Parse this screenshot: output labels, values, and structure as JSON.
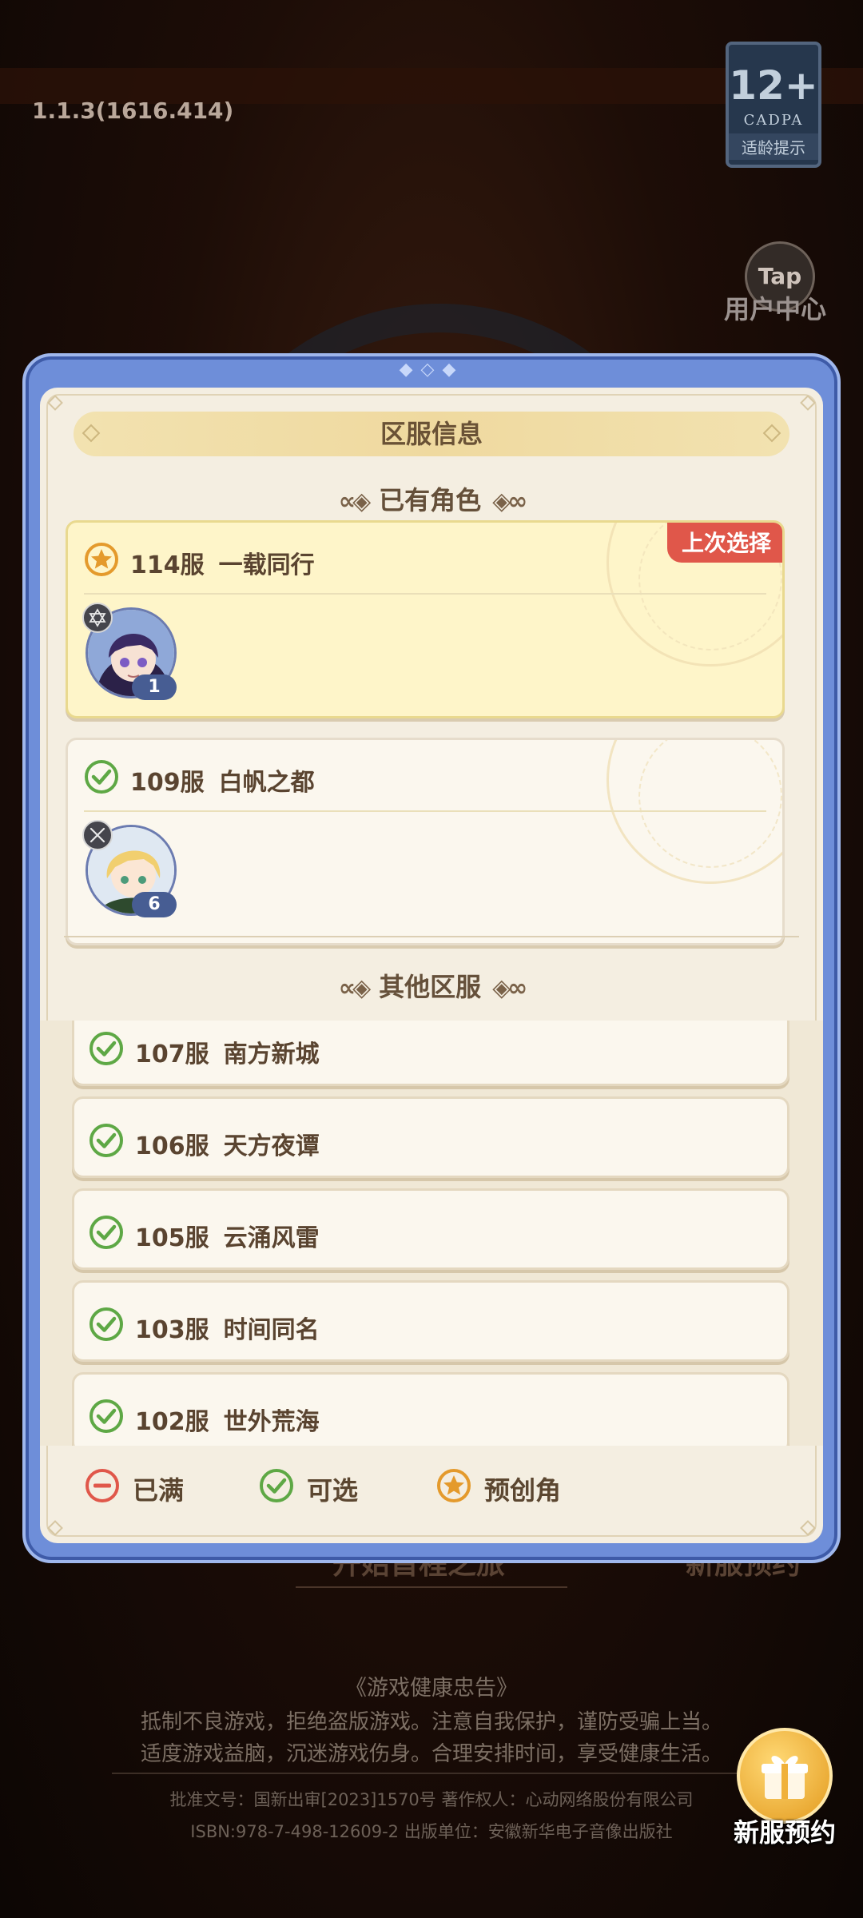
{
  "background": {
    "version": "1.1.3(1616.414)",
    "age_rating": {
      "number": "12+",
      "org": "CADPA",
      "label": "适龄提示"
    },
    "tap_logo": "Tap",
    "user_center": "用户中心",
    "start_button_partial": "开始首程之旅",
    "reserve_button_partial": "新服预约",
    "health_title": "《游戏健康忠告》",
    "health_line1": "抵制不良游戏，拒绝盗版游戏。注意自我保护，谨防受骗上当。",
    "health_line2": "适度游戏益脑，沉迷游戏伤身。合理安排时间，享受健康生活。",
    "approval_line1": "批准文号：国新出审[2023]1570号 著作权人：心动网络股份有限公司",
    "approval_line2": "ISBN:978-7-498-12609-2 出版单位：安徽新华电子音像出版社",
    "new_server_label": "新服预约"
  },
  "dialog": {
    "title": "区服信息",
    "existing_header": "已有角色",
    "other_header": "其他区服",
    "existing": [
      {
        "number": "114服",
        "name": "一载同行",
        "status": "star",
        "badge": "上次选择",
        "level": "1",
        "selected": true
      },
      {
        "number": "109服",
        "name": "白帆之都",
        "status": "check",
        "level": "6",
        "selected": false
      }
    ],
    "others": [
      {
        "number": "107服",
        "name": "南方新城",
        "status": "check"
      },
      {
        "number": "106服",
        "name": "天方夜谭",
        "status": "check"
      },
      {
        "number": "105服",
        "name": "云涌风雷",
        "status": "check"
      },
      {
        "number": "103服",
        "name": "时间同名",
        "status": "check"
      },
      {
        "number": "102服",
        "name": "世外荒海",
        "status": "check"
      }
    ],
    "legend": [
      {
        "icon": "full",
        "label": "已满"
      },
      {
        "icon": "check",
        "label": "可选"
      },
      {
        "icon": "star",
        "label": "预创角"
      }
    ],
    "colors": {
      "full": "#e0574a",
      "check": "#5ea845",
      "star": "#e49a2c",
      "frame": "#6e8ed9"
    }
  }
}
